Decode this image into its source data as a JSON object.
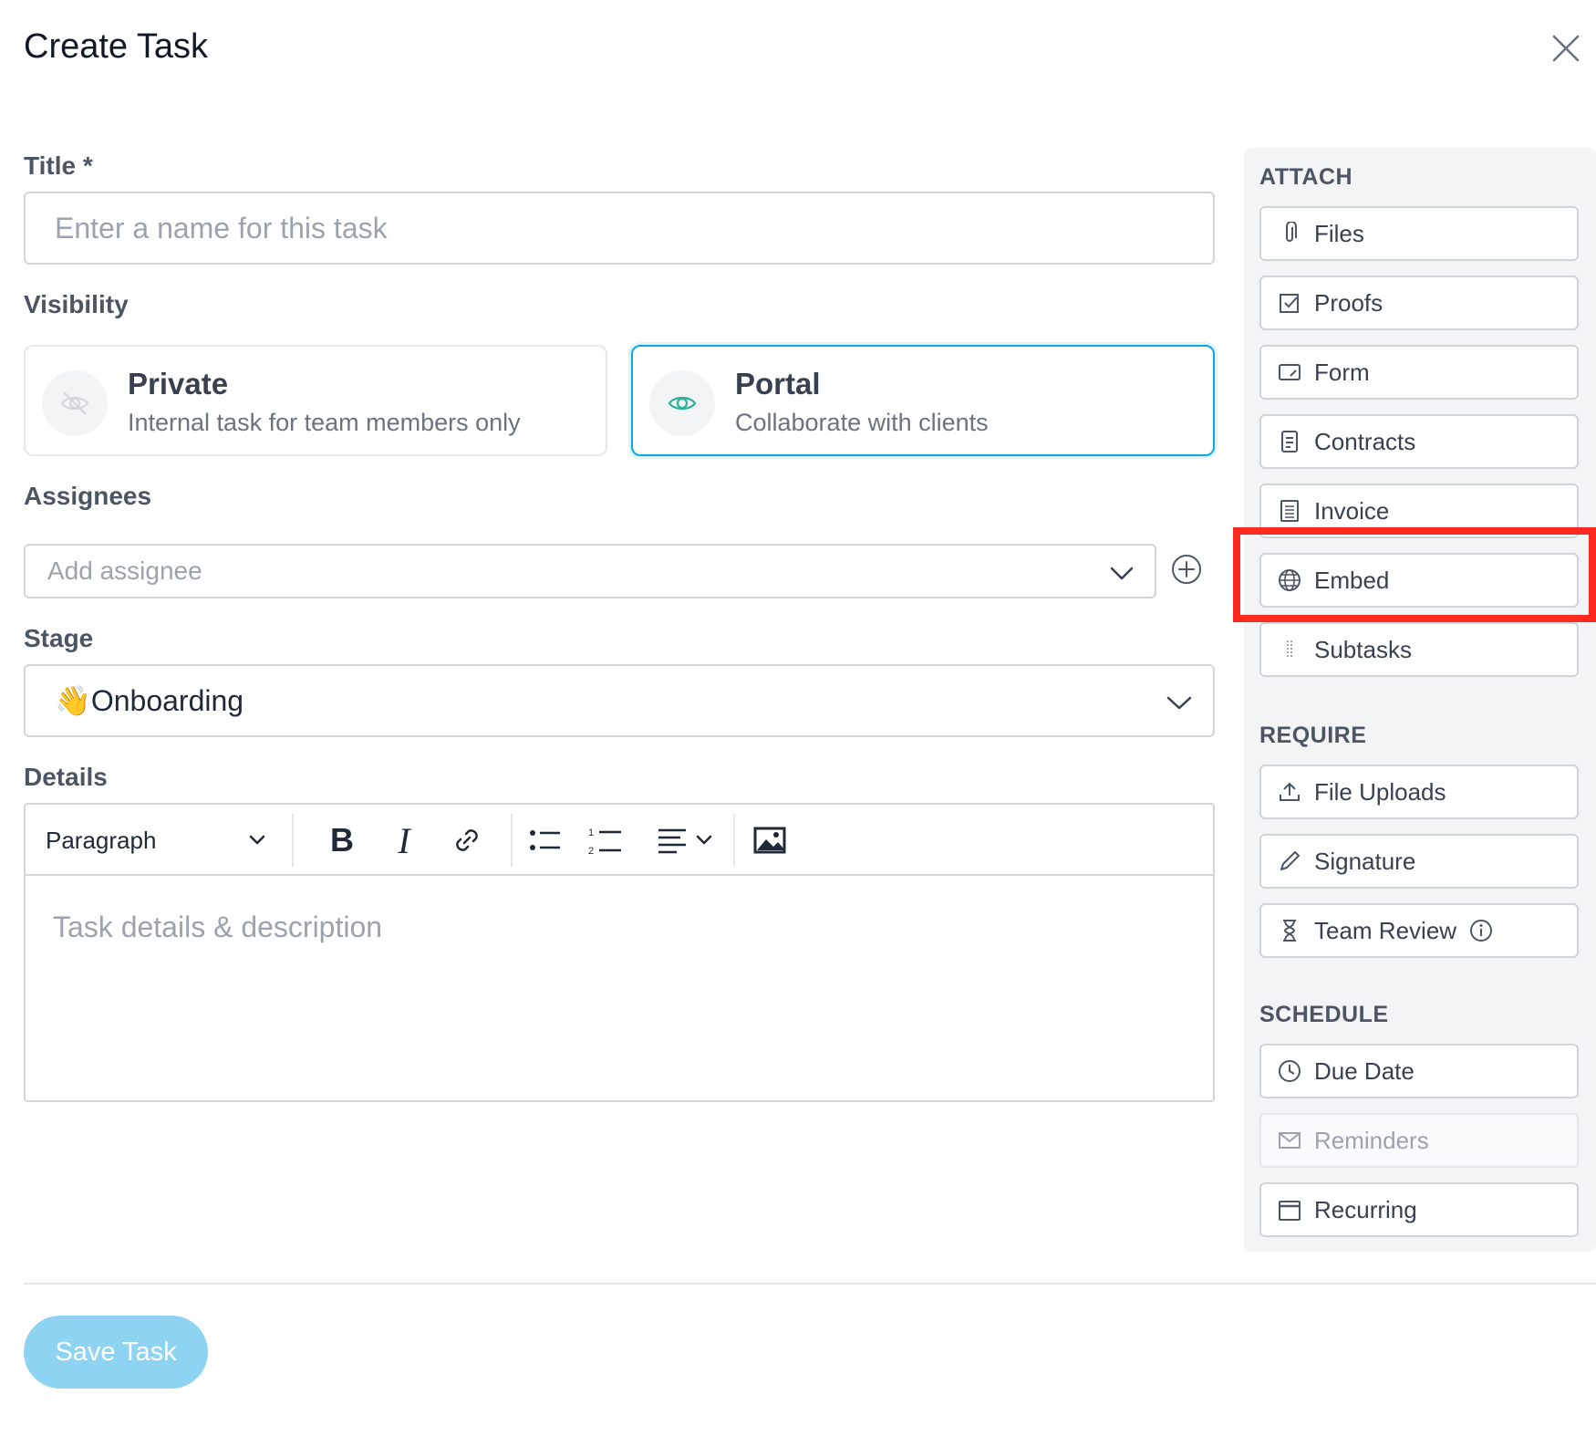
{
  "modal": {
    "title": "Create Task"
  },
  "form": {
    "title_label": "Title *",
    "title_placeholder": "Enter a name for this task",
    "visibility_label": "Visibility",
    "visibility_options": [
      {
        "title": "Private",
        "subtitle": "Internal task for team members only",
        "selected": false
      },
      {
        "title": "Portal",
        "subtitle": "Collaborate with clients",
        "selected": true
      }
    ],
    "assignees_label": "Assignees",
    "assignee_placeholder": "Add assignee",
    "stage_label": "Stage",
    "stage_emoji": "👋",
    "stage_value": "Onboarding",
    "details_label": "Details",
    "editor": {
      "block_format": "Paragraph",
      "placeholder": "Task details & description"
    },
    "save_label": "Save Task"
  },
  "panel": {
    "attach": {
      "heading": "ATTACH",
      "items": [
        {
          "label": "Files",
          "icon": "paperclip-icon"
        },
        {
          "label": "Proofs",
          "icon": "checkbox-icon"
        },
        {
          "label": "Form",
          "icon": "form-icon"
        },
        {
          "label": "Contracts",
          "icon": "document-icon"
        },
        {
          "label": "Invoice",
          "icon": "invoice-icon"
        },
        {
          "label": "Embed",
          "icon": "globe-icon"
        },
        {
          "label": "Subtasks",
          "icon": "list-icon"
        }
      ]
    },
    "require": {
      "heading": "REQUIRE",
      "items": [
        {
          "label": "File Uploads",
          "icon": "upload-icon"
        },
        {
          "label": "Signature",
          "icon": "pen-icon"
        },
        {
          "label": "Team Review",
          "icon": "hourglass-icon"
        }
      ]
    },
    "schedule": {
      "heading": "SCHEDULE",
      "items": [
        {
          "label": "Due Date",
          "icon": "clock-icon"
        },
        {
          "label": "Reminders",
          "icon": "envelope-icon",
          "disabled": true
        },
        {
          "label": "Recurring",
          "icon": "calendar-icon"
        }
      ]
    }
  },
  "colors": {
    "accent": "#0ea5e9",
    "save_button": "#8fd3f2",
    "highlight": "#ff2a1f",
    "portal_eye": "#2bb39a"
  }
}
